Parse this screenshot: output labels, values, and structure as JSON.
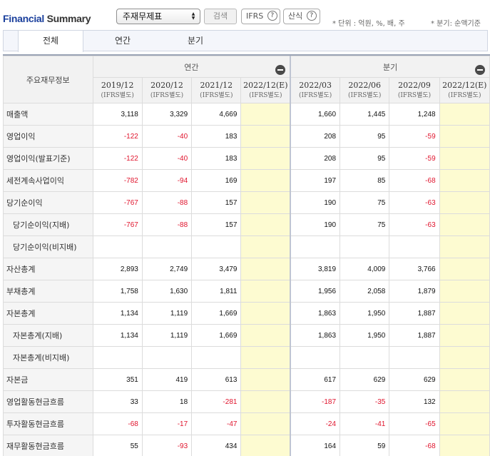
{
  "header": {
    "brand_part1": "Financial",
    "brand_part2": "Summary",
    "statement_select": "주재무제표",
    "search_button": "검색",
    "ifrs_button": "IFRS",
    "formula_button": "산식",
    "help_glyph": "?",
    "unit_note": "* 단위 : 억원, %, 배, 주",
    "period_note": "* 분기: 순액기준"
  },
  "tabs": [
    {
      "label": "전체",
      "active": true
    },
    {
      "label": "연간",
      "active": false
    },
    {
      "label": "분기",
      "active": false
    }
  ],
  "table": {
    "corner_label": "주요재무정보",
    "groups": [
      "연간",
      "분기"
    ],
    "periods": [
      {
        "label": "2019/12",
        "sub": "(IFRS별도)"
      },
      {
        "label": "2020/12",
        "sub": "(IFRS별도)"
      },
      {
        "label": "2021/12",
        "sub": "(IFRS별도)"
      },
      {
        "label": "2022/12(E)",
        "sub": "(IFRS별도)"
      },
      {
        "label": "2022/03",
        "sub": "(IFRS별도)"
      },
      {
        "label": "2022/06",
        "sub": "(IFRS별도)"
      },
      {
        "label": "2022/09",
        "sub": "(IFRS별도)"
      },
      {
        "label": "2022/12(E)",
        "sub": "(IFRS별도)"
      }
    ],
    "rows": [
      {
        "label": "매출액",
        "values": [
          "3,118",
          "3,329",
          "4,669",
          "",
          "1,660",
          "1,445",
          "1,248",
          ""
        ]
      },
      {
        "label": "영업이익",
        "values": [
          "-122",
          "-40",
          "183",
          "",
          "208",
          "95",
          "-59",
          ""
        ]
      },
      {
        "label": "영업이익(발표기준)",
        "values": [
          "-122",
          "-40",
          "183",
          "",
          "208",
          "95",
          "-59",
          ""
        ]
      },
      {
        "label": "세전계속사업이익",
        "values": [
          "-782",
          "-94",
          "169",
          "",
          "197",
          "85",
          "-68",
          ""
        ]
      },
      {
        "label": "당기순이익",
        "values": [
          "-767",
          "-88",
          "157",
          "",
          "190",
          "75",
          "-63",
          ""
        ]
      },
      {
        "label": "당기순이익(지배)",
        "indent": true,
        "values": [
          "-767",
          "-88",
          "157",
          "",
          "190",
          "75",
          "-63",
          ""
        ]
      },
      {
        "label": "당기순이익(비지배)",
        "indent": true,
        "values": [
          "",
          "",
          "",
          "",
          "",
          "",
          "",
          ""
        ]
      },
      {
        "label": "자산총계",
        "values": [
          "2,893",
          "2,749",
          "3,479",
          "",
          "3,819",
          "4,009",
          "3,766",
          ""
        ]
      },
      {
        "label": "부채총계",
        "values": [
          "1,758",
          "1,630",
          "1,811",
          "",
          "1,956",
          "2,058",
          "1,879",
          ""
        ]
      },
      {
        "label": "자본총계",
        "values": [
          "1,134",
          "1,119",
          "1,669",
          "",
          "1,863",
          "1,950",
          "1,887",
          ""
        ]
      },
      {
        "label": "자본총계(지배)",
        "indent": true,
        "values": [
          "1,134",
          "1,119",
          "1,669",
          "",
          "1,863",
          "1,950",
          "1,887",
          ""
        ]
      },
      {
        "label": "자본총계(비지배)",
        "indent": true,
        "values": [
          "",
          "",
          "",
          "",
          "",
          "",
          "",
          ""
        ]
      },
      {
        "label": "자본금",
        "values": [
          "351",
          "419",
          "613",
          "",
          "617",
          "629",
          "629",
          ""
        ]
      },
      {
        "label": "영업활동현금흐름",
        "values": [
          "33",
          "18",
          "-281",
          "",
          "-187",
          "-35",
          "132",
          ""
        ]
      },
      {
        "label": "투자활동현금흐름",
        "values": [
          "-68",
          "-17",
          "-47",
          "",
          "-24",
          "-41",
          "-65",
          ""
        ]
      },
      {
        "label": "재무활동현금흐름",
        "values": [
          "55",
          "-93",
          "434",
          "",
          "164",
          "59",
          "-68",
          ""
        ]
      }
    ]
  },
  "colors": {
    "brand_blue": "#1a3f9c",
    "negative_red": "#e0142d",
    "estimate_bg": "#fdfbd1"
  }
}
